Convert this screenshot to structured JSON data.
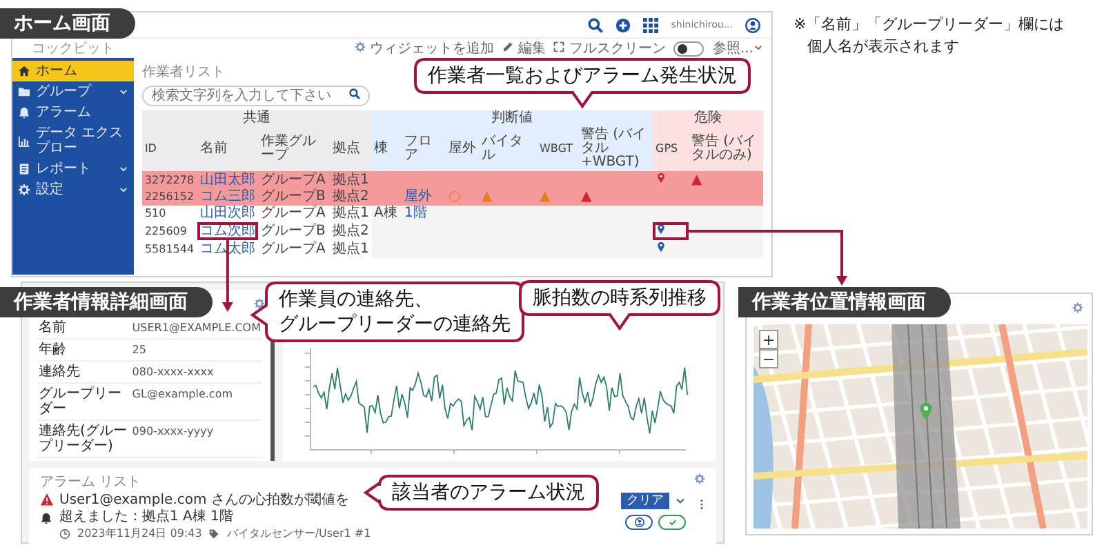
{
  "note": {
    "lines": [
      "※「名前」「グループリーダー」欄には",
      "個人名が表示されます"
    ]
  },
  "home_screen": {
    "label": "ホーム画面",
    "user": "shinichirou...",
    "brand": "コックピット",
    "toolbar": [
      {
        "kind": "add",
        "label": "ウィジェットを追加"
      },
      {
        "kind": "edit",
        "label": "編集"
      },
      {
        "kind": "fullscreen",
        "label": "フルスクリーン"
      },
      {
        "kind": "toggle",
        "on": false
      },
      {
        "kind": "dropdown",
        "label": "参照..."
      }
    ],
    "sidebar": [
      {
        "kind": "home",
        "label": "ホーム",
        "selected": true,
        "has_submenu": false
      },
      {
        "kind": "folder",
        "label": "グループ",
        "selected": false,
        "has_submenu": true
      },
      {
        "kind": "bell",
        "label": "アラーム",
        "selected": false,
        "has_submenu": false
      },
      {
        "kind": "chart",
        "label": "データ エクスプロー",
        "selected": false,
        "has_submenu": false
      },
      {
        "kind": "report",
        "label": "レポート",
        "selected": false,
        "has_submenu": true
      },
      {
        "kind": "settings",
        "label": "設定",
        "selected": false,
        "has_submenu": true
      }
    ],
    "worker_list": {
      "title": "作業者リスト",
      "callout": "作業者一覧およびアラーム発生状況",
      "search": {
        "placeholder": "検索文字列を入力して下さい"
      },
      "column_groups": [
        {
          "label": "共通",
          "color": "#ececec",
          "columns": [
            {
              "label": "ID",
              "kind": "code"
            },
            {
              "label": "名前",
              "kind": "link"
            },
            {
              "label": "作業グループ",
              "kind": "text"
            },
            {
              "label": "拠点",
              "kind": "text"
            }
          ]
        },
        {
          "label": "判断値",
          "color": "#e2eefc",
          "columns": [
            {
              "label": "棟",
              "kind": "text"
            },
            {
              "label": "フロア",
              "kind": "link"
            },
            {
              "label": "屋外",
              "kind": "warning"
            },
            {
              "label": "バイタル",
              "kind": "warning"
            },
            {
              "label": "WBGT",
              "kind": "warning"
            },
            {
              "label": "警告 (バイタル+WBGT)",
              "kind": "alert"
            }
          ]
        },
        {
          "label": "危険",
          "color": "#fde0e0",
          "columns": [
            {
              "label": "GPS",
              "kind": "pin"
            },
            {
              "label": "警告 (バイタルのみ)",
              "kind": "alert"
            }
          ]
        }
      ],
      "rows": [
        {
          "cells": [
            "3272278",
            "山田太郎",
            "グループA",
            "拠点1",
            null,
            null,
            null,
            null,
            null,
            null,
            "▲"
          ],
          "gps": {
            "color": "#d0243a"
          },
          "alert": true,
          "highlighted": false
        },
        {
          "cells": [
            "2256152",
            "コム三郎",
            "グループB",
            "拠点2",
            null,
            "屋外",
            "○",
            "▲",
            "▲",
            "▲",
            null
          ],
          "alert": true,
          "highlighted": false
        },
        {
          "cells": [
            "510",
            "山田次郎",
            "グループA",
            "拠点1",
            "A棟",
            "1階",
            null,
            null,
            null,
            null,
            null
          ],
          "alert": false,
          "highlighted": false
        },
        {
          "cells": [
            "225609",
            "コム次郎",
            "グループB",
            "拠点2",
            null,
            null,
            null,
            null,
            null,
            null,
            null
          ],
          "gps": {
            "color": "#2a5db0"
          },
          "alert": false,
          "highlighted": true
        },
        {
          "cells": [
            "5581544",
            "コム太郎",
            "グループA",
            "拠点1",
            null,
            null,
            null,
            null,
            null,
            null,
            null
          ],
          "gps": {
            "color": "#2a5db0"
          },
          "alert": false,
          "highlighted": false
        }
      ]
    }
  },
  "detail_screen": {
    "label": "作業者情報詳細画面",
    "callout": [
      "作業員の連絡先、",
      "グループリーダーの連絡先"
    ],
    "fields": [
      {
        "label": "名前",
        "value": "USER1@EXAMPLE.COM"
      },
      {
        "label": "年齢",
        "value": "25"
      },
      {
        "label": "連絡先",
        "value": "080-xxxx-xxxx"
      },
      {
        "label": "グループリーダー",
        "value": "GL@example.com"
      },
      {
        "label": "連絡先(グループリーダー)",
        "value": "090-xxxx-yyyy"
      }
    ]
  },
  "heart_rate": {
    "callout": "脈拍数の時系列推移"
  },
  "alarm_list": {
    "title": "アラーム リスト",
    "callout": "該当者のアラーム状況",
    "items": [
      {
        "message": "User1@example.com さんの心拍数が閾値を超えました：拠点1 A棟 1階",
        "time": "2023年11月24日 09:43",
        "source": "バイタルセンサー/User1 #1",
        "badge": "クリア"
      }
    ]
  },
  "location_screen": {
    "label": "作業者位置情報画面",
    "zoom_in": "+",
    "zoom_out": "−"
  }
}
